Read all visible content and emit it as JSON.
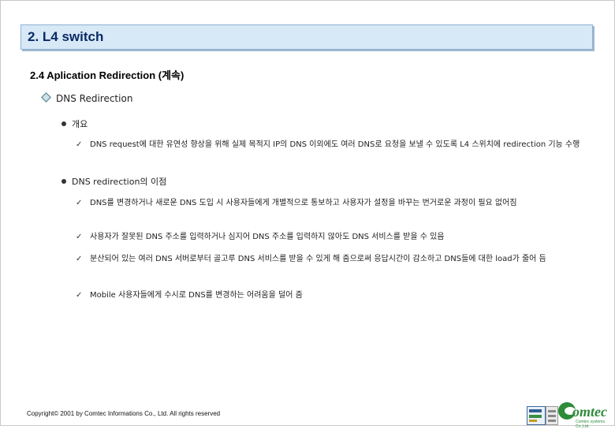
{
  "header": {
    "title": "2. L4 switch"
  },
  "section": {
    "heading": "2.4  Aplication Redirection (계속)"
  },
  "topic": {
    "label": "DNS Redirection"
  },
  "bullets": [
    {
      "label": "개요",
      "items": [
        "DNS request에 대한 유연성 향상을 위해 실제 목적지 IP의 DNS 이외에도 여러 DNS로 요청을 보낼 수 있도록 L4 스위치에 redirection 기능 수행"
      ]
    },
    {
      "label": "DNS redirection의 이점",
      "items": [
        "DNS를 변경하거나 새로운 DNS 도입 시 사용자들에게 개별적으로 통보하고 사용자가 설정을 바꾸는 번거로운 과정이 필요 없어짐",
        "사용자가 잘못된 DNS 주소를 입력하거나 심지어 DNS 주소를 입력하지 않아도 DNS 서비스를 받을 수 있음",
        "분산되어 있는 여러 DNS 서버로부터 골고루 DNS 서비스를 받을 수 있게 해 줌으로써 응답시간이 감소하고 DNS들에 대한 load가 줄어 듬",
        "Mobile 사용자들에게 수시로 DNS를 변경하는 어려움을 덜어 줌"
      ]
    }
  ],
  "check_mark": "✓",
  "footer": {
    "copyright": "Copyright© 2001 by Comtec Informations Co., Ltd. All rights reserved"
  },
  "brand": {
    "name": "omtec",
    "tagline": "Comtec systems Co.,Ltd."
  },
  "colors": {
    "title_bg": "#d7e8f6",
    "title_text": "#0a2a66",
    "brand_green": "#2e8b3a"
  }
}
